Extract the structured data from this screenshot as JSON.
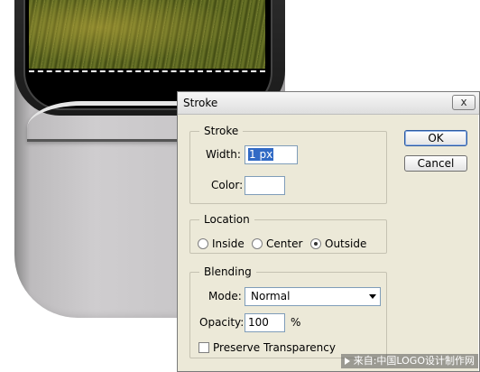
{
  "dialog": {
    "title": "Stroke",
    "close_glyph": "x"
  },
  "stroke_group": {
    "legend": "Stroke",
    "width_label": "Width:",
    "width_value": "1 px",
    "color_label": "Color:",
    "color_value": "#ffffff"
  },
  "location_group": {
    "legend": "Location",
    "options": [
      "Inside",
      "Center",
      "Outside"
    ],
    "selected": "Outside"
  },
  "blending_group": {
    "legend": "Blending",
    "mode_label": "Mode:",
    "mode_value": "Normal",
    "opacity_label": "Opacity:",
    "opacity_value": "100",
    "opacity_unit": "%",
    "preserve_label": "Preserve Transparency",
    "preserve_checked": false
  },
  "buttons": {
    "ok": "OK",
    "cancel": "Cancel"
  },
  "watermark": {
    "text": "来自:中国LOGO设计制作网"
  },
  "colors": {
    "dialog_bg": "#ece9d8",
    "selection_highlight": "#316ac5"
  }
}
